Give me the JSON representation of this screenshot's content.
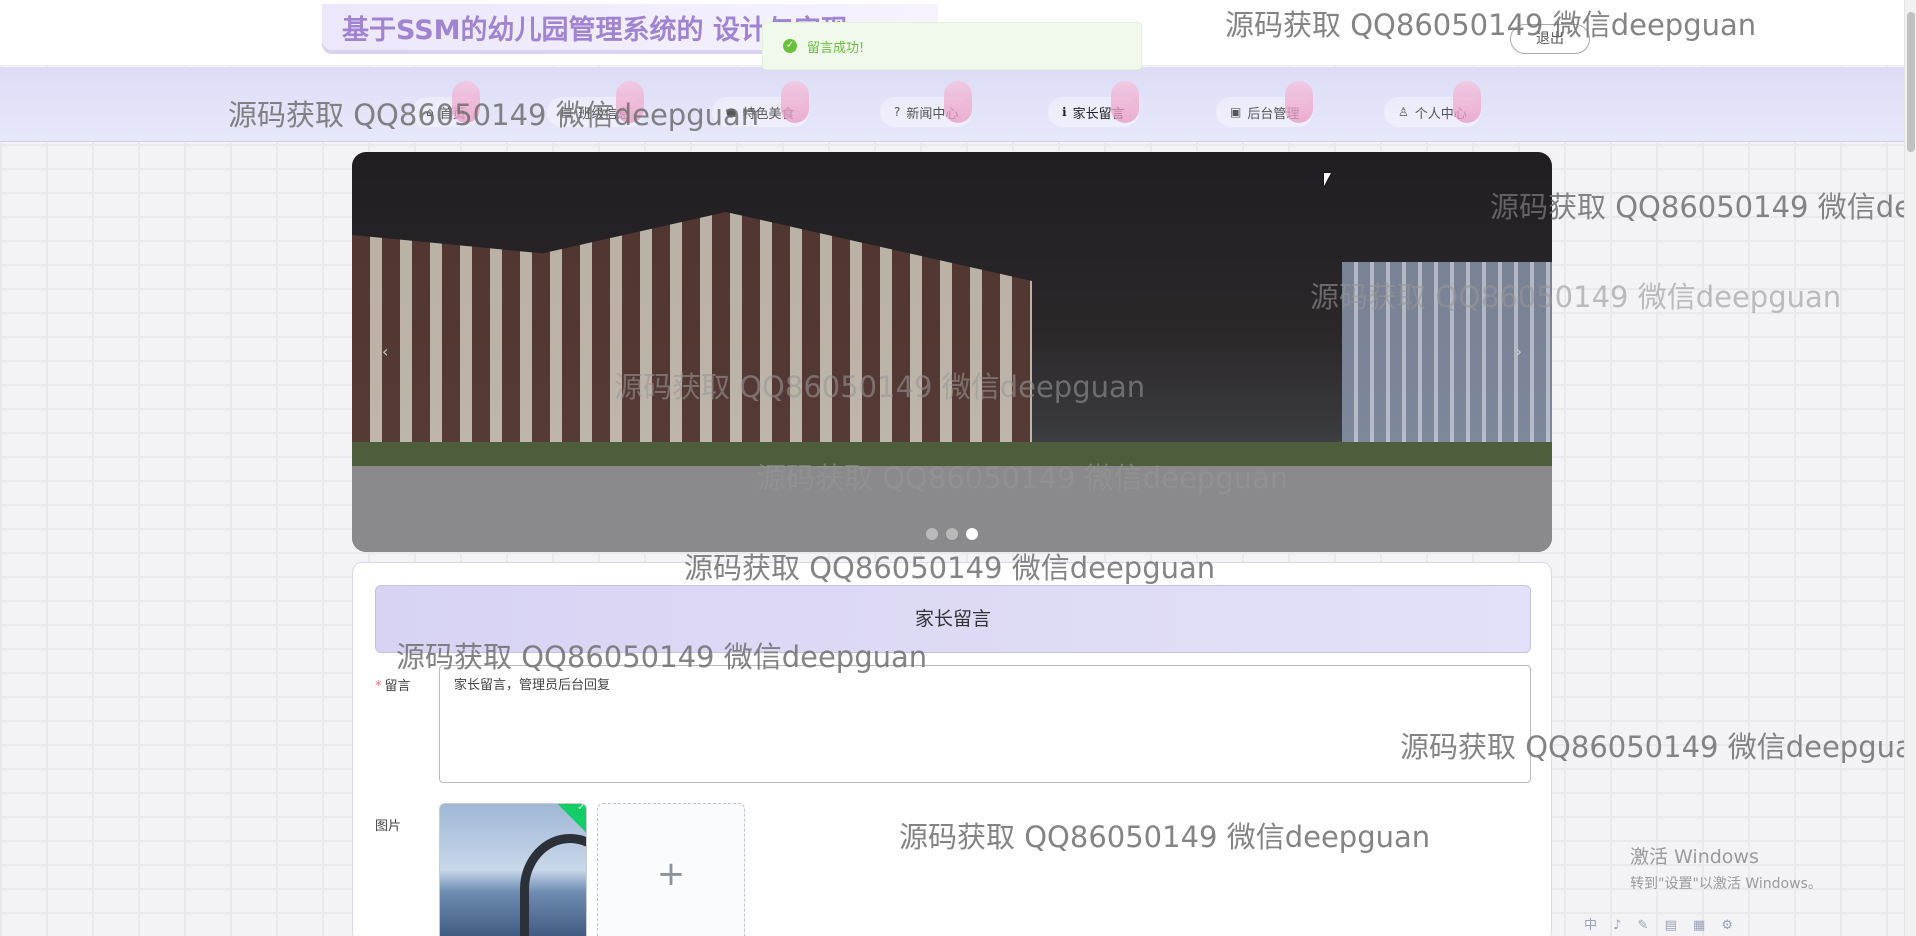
{
  "header": {
    "site_title": "基于SSM的幼儿园管理系统的 设计与实现",
    "logout_label": "退出",
    "toast": "留言成功!"
  },
  "nav": {
    "items": [
      {
        "label": "首页",
        "icon": "home-icon"
      },
      {
        "label": "班级信息",
        "icon": "list-icon"
      },
      {
        "label": "特色美食",
        "icon": "food-icon"
      },
      {
        "label": "新闻中心",
        "icon": "question-icon"
      },
      {
        "label": "家长留言",
        "icon": "info-icon"
      },
      {
        "label": "后台管理",
        "icon": "clipboard-icon"
      },
      {
        "label": "个人中心",
        "icon": "user-icon"
      }
    ],
    "active_index": 4
  },
  "banner": {
    "prev_symbol": "‹",
    "next_symbol": "›",
    "slide_count": 3,
    "active_slide": 3
  },
  "form": {
    "heading": "家长留言",
    "message_label": "留言",
    "message_value": "家长留言，管理员后台回复",
    "image_label": "图片",
    "upload_symbol": "+"
  },
  "watermark": "源码获取 QQ86050149 微信deepguan",
  "system": {
    "activate_title": "激活 Windows",
    "activate_hint": "转到\"设置\"以激活 Windows。",
    "tray": "中 ♪ ✎ ▤ ▦ ⚙"
  },
  "colors": {
    "title_text": "#a184d1",
    "nav_bg": "#dcdcf6",
    "success": "#67c23a",
    "required": "#f56c6c"
  }
}
